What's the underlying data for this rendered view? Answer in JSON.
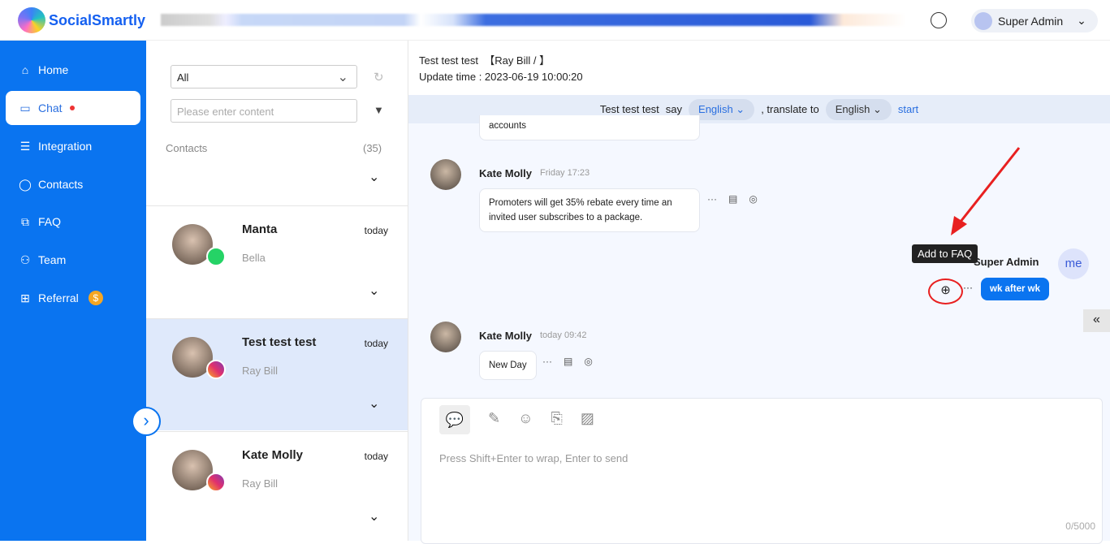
{
  "header": {
    "brand": "SocialSmartly",
    "user": "Super Admin"
  },
  "sidebar": {
    "items": [
      {
        "label": "Home",
        "icon": "home-icon"
      },
      {
        "label": "Chat",
        "icon": "chat-icon"
      },
      {
        "label": "Integration",
        "icon": "list-icon"
      },
      {
        "label": "Contacts",
        "icon": "user-icon"
      },
      {
        "label": "FAQ",
        "icon": "faq-icon"
      },
      {
        "label": "Team",
        "icon": "team-icon"
      },
      {
        "label": "Referral",
        "icon": "gift-icon"
      }
    ]
  },
  "list": {
    "filter": "All",
    "search_placeholder": "Please enter content",
    "contacts_label": "Contacts",
    "contacts_count": "(35)",
    "contacts": [
      {
        "name": "Manta",
        "time": "today",
        "sub": "Bella",
        "channel": "whatsapp"
      },
      {
        "name": "Test test test",
        "time": "today",
        "sub": "Ray Bill",
        "channel": "instagram"
      },
      {
        "name": "Kate Molly",
        "time": "today",
        "sub": "Ray Bill",
        "channel": "instagram"
      }
    ]
  },
  "chat": {
    "title": "Test test test  【Ray Bill / 】",
    "update": "Update time : 2023-06-19 10:00:20",
    "translate": {
      "who": "Test test test",
      "say": "say",
      "from": "English",
      "to_label": ", translate to",
      "to": "English",
      "start": "start"
    },
    "messages": [
      {
        "text": "accounts"
      },
      {
        "name": "Kate Molly",
        "time": "Friday 17:23",
        "text": "Promoters will get 35% rebate every time an invited user subscribes to a package."
      },
      {
        "name": "Super Admin",
        "avatar": "me",
        "text": "wk after wk",
        "tooltip": "Add to FAQ"
      },
      {
        "name": "Kate Molly",
        "time": "today 09:42",
        "text": "New Day"
      }
    ],
    "input_placeholder": "Press Shift+Enter to wrap, Enter to send",
    "counter": "0/5000"
  },
  "colors": {
    "sidebar": "#0a74f0",
    "accent": "#2a6fe0",
    "annotation": "#e82020"
  }
}
